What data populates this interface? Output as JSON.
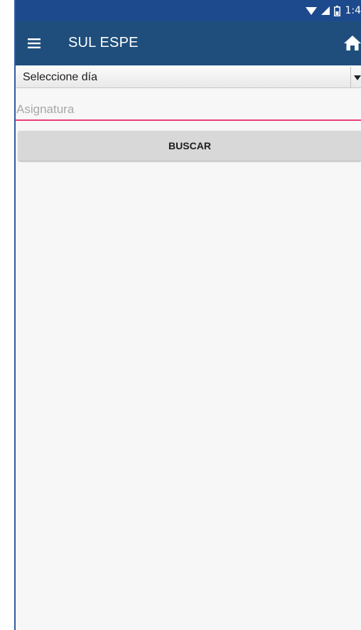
{
  "status_bar": {
    "time": "1:4",
    "background": "#1d4a8c",
    "icons": [
      "wifi-icon",
      "signal-icon",
      "battery-icon"
    ]
  },
  "app_bar": {
    "title": "SUL ESPE",
    "background": "#1f4e7c",
    "menu_icon": "hamburger-menu-icon",
    "action_icon": "home-icon"
  },
  "form": {
    "day_spinner": {
      "selected_label": "Seleccione día",
      "arrow_icon": "dropdown-arrow-icon"
    },
    "subject_input": {
      "placeholder": "Asignatura",
      "value": "",
      "underline_color": "#e8407a"
    },
    "search_button": {
      "label": "BUSCAR"
    }
  }
}
